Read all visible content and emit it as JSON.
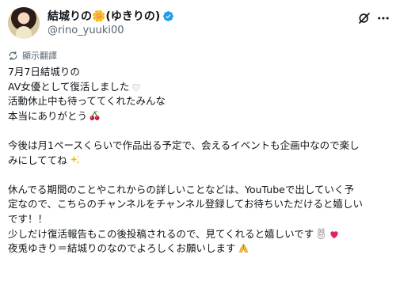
{
  "post": {
    "author": {
      "display_name": "結城りの🌼(ゆきりの)",
      "handle": "@rino_yuuki00",
      "verified": true
    },
    "header_icons": [
      "grok-icon",
      "more-icon"
    ],
    "translate_label": "顯示翻譯",
    "body_lines": [
      "7月7日結城りの",
      "AV女優として復活しました",
      "活動休止中も待っててくれたみんな",
      "本当にありがとう",
      "",
      "今後は月1ペースくらいで作品出る予定で、会えるイベントも企画中なので楽し",
      "みにしててね",
      "",
      "休んでる期間のことやこれからの詳しいことなどは、YouTubeで出していく予",
      "定なので、こちらのチャンネルをチャンネル登録してお待ちいただけると嬉しい",
      "です！！",
      "少しだけ復活報告もこの後投稿されるので、見てくれると嬉しいです",
      "夜兎ゆきり＝結城りのなのでよろしくお願いします"
    ],
    "emojis": {
      "line_1": "white-heart",
      "line_3": "cherries",
      "line_6": "sparkles",
      "line_11": [
        "rabbit",
        "red-heart"
      ],
      "line_12": "folded-hands"
    }
  },
  "colors": {
    "text": "#0f1419",
    "secondary_text": "#536471",
    "verified_blue": "#1d9bf0",
    "background": "#ffffff"
  }
}
